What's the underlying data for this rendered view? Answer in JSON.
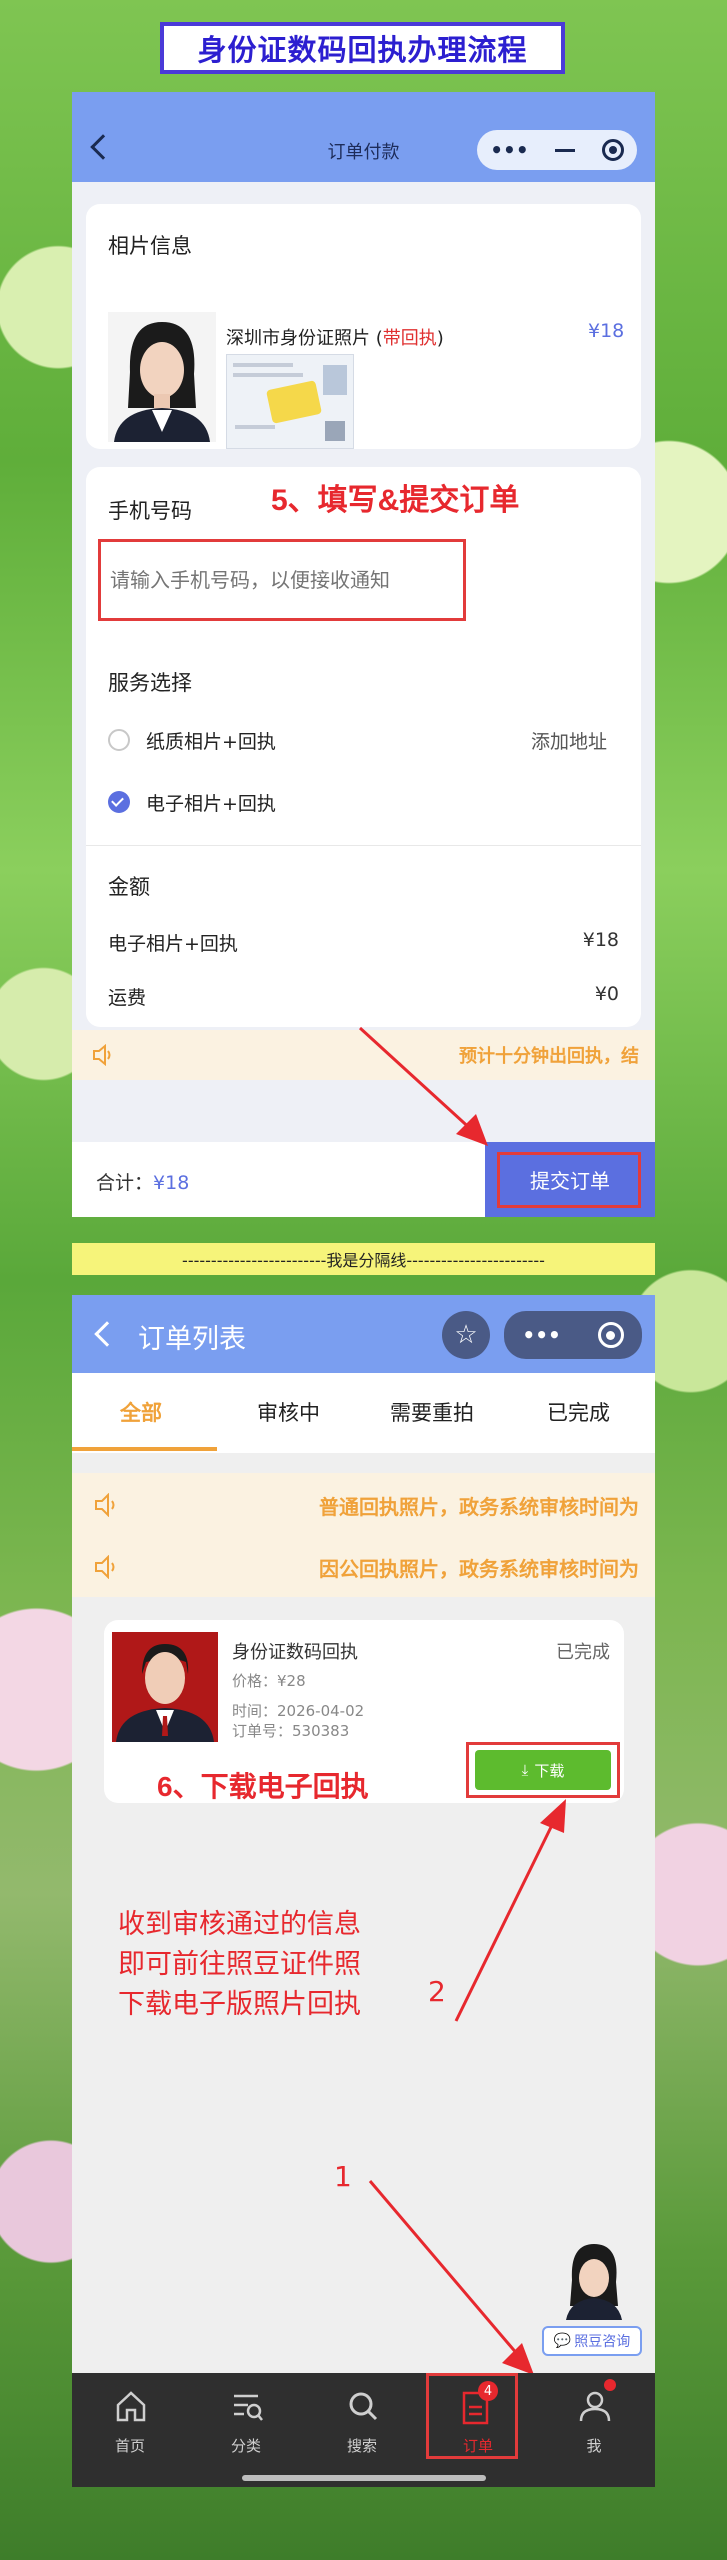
{
  "banner_title": "身份证数码回执办理流程",
  "screen1": {
    "nav_title": "订单付款",
    "photo_section_title": "相片信息",
    "product_name_prefix": "深圳市身份证照片 (",
    "product_name_highlight": "带回执",
    "product_name_suffix": ")",
    "product_price": "¥18",
    "phone_section_title": "手机号码",
    "phone_placeholder": "请输入手机号码，以便接收通知",
    "annotation_step5": "5、填写&提交订单",
    "service_section_title": "服务选择",
    "service_options": [
      {
        "label": "纸质相片+回执",
        "selected": false,
        "action": "添加地址"
      },
      {
        "label": "电子相片+回执",
        "selected": true,
        "action": ""
      }
    ],
    "amount_section_title": "金额",
    "amount_rows": [
      {
        "label": "电子相片+回执",
        "value": "¥18"
      },
      {
        "label": "运费",
        "value": "¥0"
      }
    ],
    "notice_text": "预计十分钟出回执，结",
    "total_label": "合计：",
    "total_value": "¥18",
    "submit_label": "提交订单"
  },
  "separator_text": "-------------------------我是分隔线------------------------",
  "screen2": {
    "nav_title": "订单列表",
    "tabs": [
      "全部",
      "审核中",
      "需要重拍",
      "已完成"
    ],
    "active_tab": 0,
    "notices": [
      "普通回执照片，政务系统审核时间为",
      "因公回执照片，政务系统审核时间为"
    ],
    "order": {
      "title": "身份证数码回执",
      "status": "已完成",
      "price": "价格：¥28",
      "time": "时间：2026-04-02",
      "order_no": "订单号：530383",
      "download_label": "下载"
    },
    "annotation_step6": "6、下载电子回执",
    "annotation_instructions": [
      "收到审核通过的信息",
      "即可前往照豆证件照",
      "下载电子版照片回执"
    ],
    "arrow_label_1": "1",
    "arrow_label_2": "2",
    "consult_label": "照豆咨询",
    "tabbar": [
      {
        "label": "首页",
        "icon": "home-icon"
      },
      {
        "label": "分类",
        "icon": "category-search-icon"
      },
      {
        "label": "搜索",
        "icon": "search-icon"
      },
      {
        "label": "订单",
        "icon": "order-document-icon",
        "badge": "4",
        "active": true
      },
      {
        "label": "我",
        "icon": "person-icon"
      }
    ]
  },
  "colors": {
    "nav_blue": "#7a9ef0",
    "accent_blue": "#5b6fe0",
    "annotation_red": "#e7282e",
    "tab_active": "#f0a23a",
    "download_green": "#5dbb2e"
  }
}
